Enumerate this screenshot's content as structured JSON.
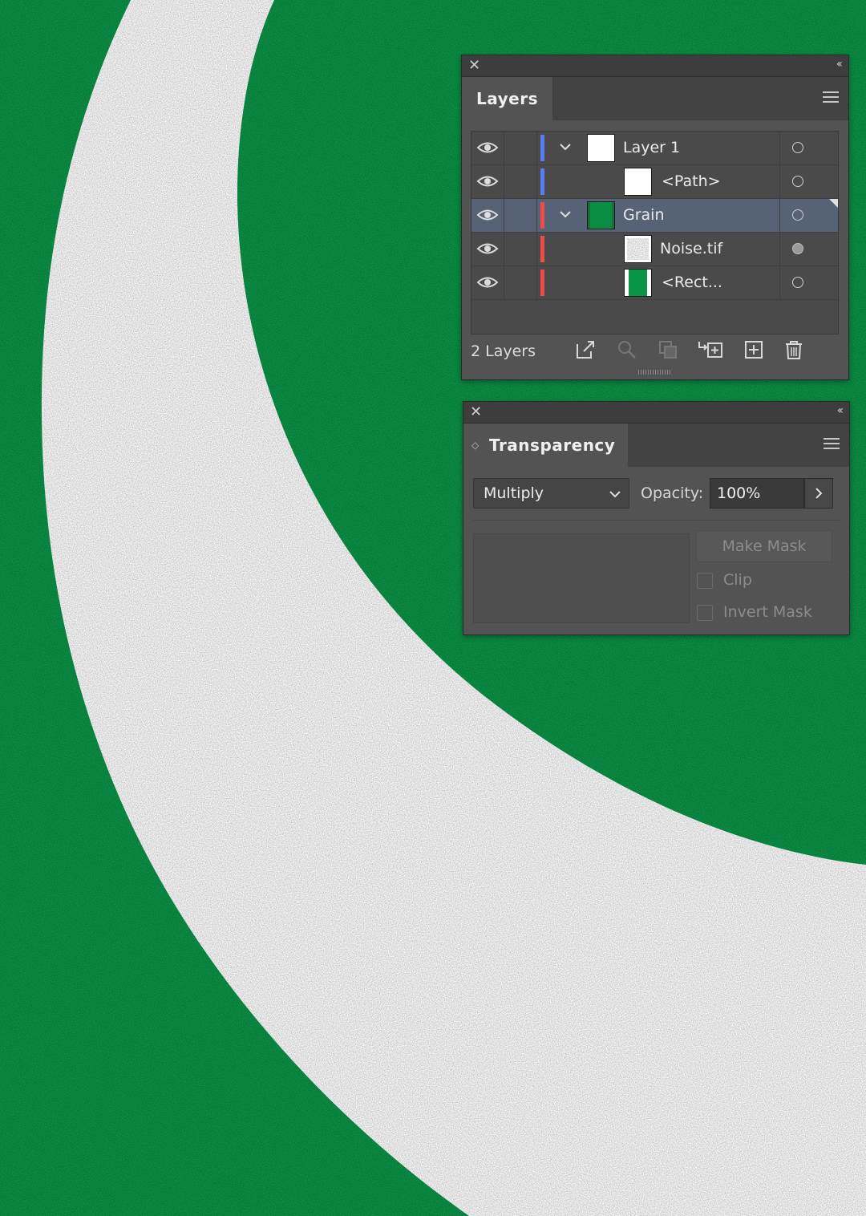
{
  "artwork": {
    "background_color": "#0a9447",
    "shape_color": "#ffffff"
  },
  "layers_panel": {
    "close_icon": "close-icon",
    "collapse_icon": "collapse-icon",
    "tab_label": "Layers",
    "rows": [
      {
        "name": "Layer 1",
        "color": "#5b7cf0",
        "expanded": true,
        "selected": false,
        "target": "empty",
        "thumb": "white"
      },
      {
        "name": "<Path>",
        "color": "#5b7cf0",
        "expanded": null,
        "selected": false,
        "target": "empty",
        "thumb": "white"
      },
      {
        "name": "Grain",
        "color": "#ef4b4b",
        "expanded": true,
        "selected": true,
        "target": "empty",
        "thumb": "grain"
      },
      {
        "name": "Noise.tif",
        "color": "#ef4b4b",
        "expanded": null,
        "selected": false,
        "target": "filled",
        "thumb": "noise"
      },
      {
        "name": "<Rect...",
        "color": "#ef4b4b",
        "expanded": null,
        "selected": false,
        "target": "empty",
        "thumb": "rect"
      }
    ],
    "footer": {
      "count_label": "2 Layers"
    }
  },
  "transparency_panel": {
    "tab_label": "Transparency",
    "blend_mode": "Multiply",
    "opacity_label": "Opacity:",
    "opacity_value": "100%",
    "make_mask_label": "Make Mask",
    "clip_label": "Clip",
    "invert_mask_label": "Invert Mask"
  }
}
